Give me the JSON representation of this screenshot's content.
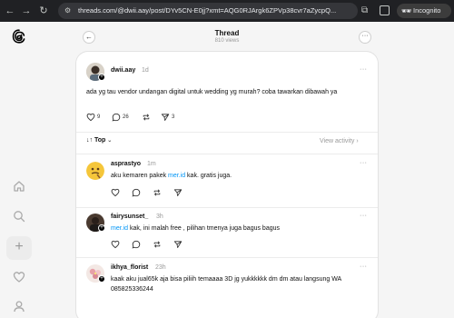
{
  "browser": {
    "url": "threads.com/@dwii.aay/post/DYv5CN-E0jj?xmt=AQG0RJArgk6ZPVp38cvr7aZycpQ...",
    "incognito_label": "Incognito"
  },
  "colors": {
    "mention": "#0095f6",
    "muted": "#999999",
    "text": "#101010"
  },
  "header": {
    "title": "Thread",
    "views": "810 views"
  },
  "post": {
    "username": "dwii.aay",
    "time": "1d",
    "text": "ada yg tau vendor undangan digital untuk wedding yg murah? coba tawarkan dibawah ya",
    "likes": "9",
    "comments": "26",
    "shares": "3"
  },
  "sort": {
    "label": "Top",
    "activity": "View activity"
  },
  "replies": [
    {
      "username": "asprastyo",
      "time": "1m",
      "mention": "mer.id",
      "pre": "aku kemaren pakek ",
      "post": " kak. gratis juga."
    },
    {
      "username": "fairysunset_",
      "time": "3h",
      "mention": "mer.id",
      "pre": "",
      "post": " kak, ini malah free , pilihan tmenya juga bagus bagus"
    },
    {
      "username": "ikhya_florist",
      "time": "23h",
      "text": "kaak aku jual65k aja bisa piliih temaaaa 3D jg yukkkkkk dm dm atau langsung WA 085825336244"
    }
  ]
}
